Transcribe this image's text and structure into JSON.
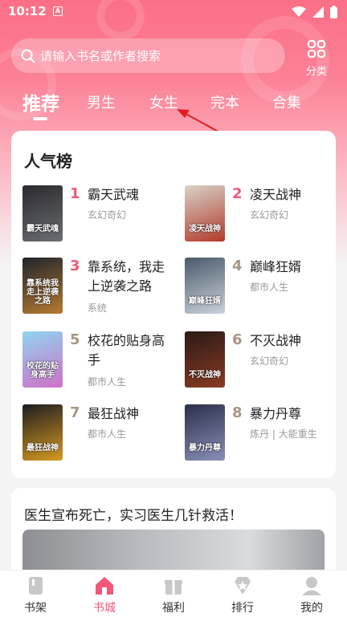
{
  "status": {
    "time": "10:12",
    "notif_letter": "A"
  },
  "search": {
    "placeholder": "请输入书名或作者搜索"
  },
  "category": {
    "label": "分类"
  },
  "tabs": [
    {
      "label": "推荐",
      "active": true
    },
    {
      "label": "男生",
      "active": false
    },
    {
      "label": "女生",
      "active": false
    },
    {
      "label": "完本",
      "active": false
    },
    {
      "label": "合集",
      "active": false
    }
  ],
  "popular": {
    "title": "人气榜",
    "books": [
      {
        "rank": "1",
        "name": "霸天武魂",
        "genre": "玄幻奇幻",
        "cover_text": "霸天武魂",
        "cover_colors": [
          "#2a2a2e",
          "#6b6d72"
        ]
      },
      {
        "rank": "2",
        "name": "凌天战神",
        "genre": "玄幻奇幻",
        "cover_text": "凌天战神",
        "cover_colors": [
          "#d8d2c8",
          "#b33a2a"
        ]
      },
      {
        "rank": "3",
        "name": "靠系统，我走上逆袭之路",
        "genre": "系统",
        "cover_text": "靠系统我走上逆袭之路",
        "cover_colors": [
          "#20242c",
          "#b67a30"
        ]
      },
      {
        "rank": "4",
        "name": "巅峰狂婿",
        "genre": "都市人生",
        "cover_text": "巅峰狂婿",
        "cover_colors": [
          "#4a5a6a",
          "#c9d2da"
        ]
      },
      {
        "rank": "5",
        "name": "校花的贴身高手",
        "genre": "都市人生",
        "cover_text": "校花的贴身高手",
        "cover_colors": [
          "#8fd4f0",
          "#d070c8"
        ]
      },
      {
        "rank": "6",
        "name": "不灭战神",
        "genre": "玄幻奇幻",
        "cover_text": "不灭战神",
        "cover_colors": [
          "#2a1a16",
          "#8a3a24"
        ]
      },
      {
        "rank": "7",
        "name": "最狂战神",
        "genre": "都市人生",
        "cover_text": "最狂战神",
        "cover_colors": [
          "#1c1c20",
          "#d89a20"
        ]
      },
      {
        "rank": "8",
        "name": "暴力丹尊",
        "genre": "炼丹 | 大能重生",
        "cover_text": "暴力丹尊",
        "cover_colors": [
          "#2a2f4a",
          "#8a8fb8"
        ]
      }
    ]
  },
  "feature": {
    "title": "医生宣布死亡，实习医生几针救活！"
  },
  "nav": [
    {
      "label": "书架",
      "active": false
    },
    {
      "label": "书城",
      "active": true
    },
    {
      "label": "福利",
      "active": false
    },
    {
      "label": "排行",
      "active": false
    },
    {
      "label": "我的",
      "active": false
    }
  ],
  "colors": {
    "accent": "#f25878",
    "rank_top3": "#f05a77",
    "rank_other": "#a99684"
  }
}
